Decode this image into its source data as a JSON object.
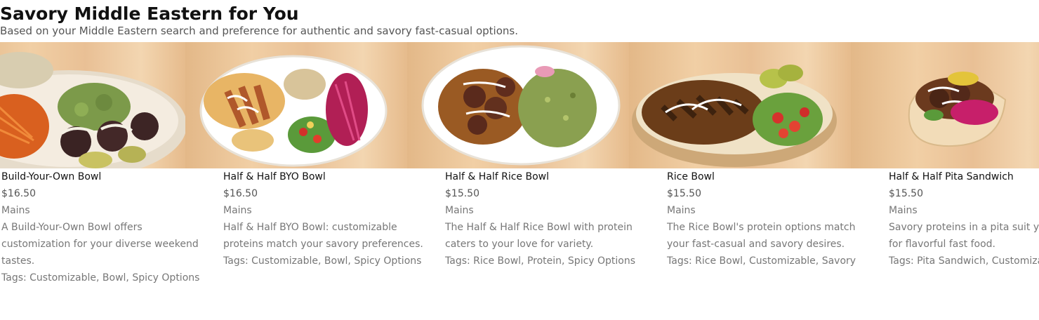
{
  "section": {
    "title": "Savory Middle Eastern for You",
    "subtitle": "Based on your Middle Eastern search and preference for authentic and savory fast-casual options."
  },
  "items": [
    {
      "name": "Build-Your-Own Bowl",
      "price": "$16.50",
      "category": "Mains",
      "description": "A Build-Your-Own Bowl offers customization for your diverse weekend tastes.",
      "tags": "Tags: Customizable, Bowl, Spicy Options",
      "image_icon": "byo-bowl-photo"
    },
    {
      "name": "Half & Half BYO Bowl",
      "price": "$16.50",
      "category": "Mains",
      "description": "Half & Half BYO Bowl: customizable proteins match your savory preferences.",
      "tags": "Tags: Customizable, Bowl, Spicy Options",
      "image_icon": "half-half-byo-bowl-photo"
    },
    {
      "name": "Half & Half Rice Bowl",
      "price": "$15.50",
      "category": "Mains",
      "description": "The Half & Half Rice Bowl with protein caters to your love for variety.",
      "tags": "Tags: Rice Bowl, Protein, Spicy Options",
      "image_icon": "half-half-rice-bowl-photo"
    },
    {
      "name": "Rice Bowl",
      "price": "$15.50",
      "category": "Mains",
      "description": "The Rice Bowl's protein options match your fast-casual and savory desires.",
      "tags": "Tags: Rice Bowl, Customizable, Savory",
      "image_icon": "rice-bowl-photo"
    },
    {
      "name": "Half & Half Pita Sandwich",
      "price": "$15.50",
      "category": "Mains",
      "description": "Savory proteins in a pita suit your craving for flavorful fast food.",
      "tags": "Tags: Pita Sandwich, Customiza",
      "image_icon": "pita-sandwich-photo"
    }
  ]
}
